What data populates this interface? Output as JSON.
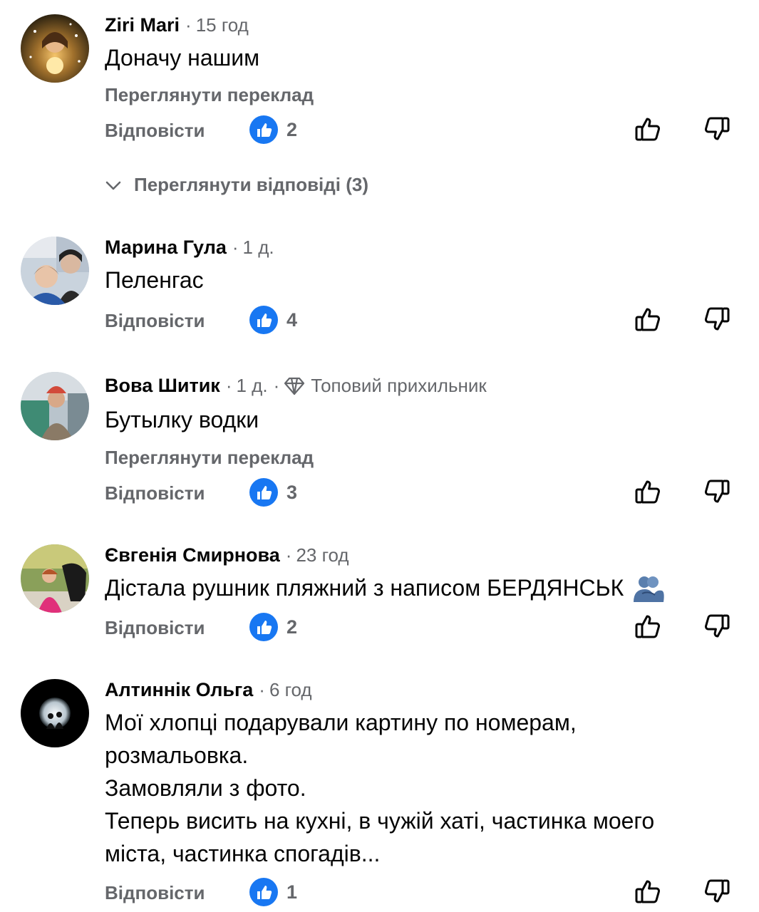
{
  "colors": {
    "accent": "#1877f2",
    "secondary": "#65676b",
    "text": "#050505"
  },
  "comments": [
    {
      "author": "Ziri Mari",
      "time": "15 год",
      "badge": "",
      "text_lines": [
        "Доначу нашим"
      ],
      "translate": "Переглянути переклад",
      "reply": "Відповісти",
      "likes": "2"
    },
    {
      "author": "Марина Гула",
      "time": "1 д.",
      "badge": "",
      "text_lines": [
        "Пеленгас"
      ],
      "translate": "",
      "reply": "Відповісти",
      "likes": "4"
    },
    {
      "author": "Вова Шитик",
      "time": "1 д.",
      "badge": "Топовий прихильник",
      "text_lines": [
        "Бутылку водки"
      ],
      "translate": "Переглянути переклад",
      "reply": "Відповісти",
      "likes": "3"
    },
    {
      "author": "Євгенія Смирнова",
      "time": "23 год",
      "badge": "",
      "text_lines": [
        "Дістала рушник пляжний з написом БЕРДЯНСЬК"
      ],
      "translate": "",
      "reply": "Відповісти",
      "likes": "2"
    },
    {
      "author": "Алтиннік Ольга",
      "time": "6 год",
      "badge": "",
      "text_lines": [
        "Мої хлопці подарували картину по номерам,",
        "розмальовка.",
        "Замовляли з фото.",
        "Теперь висить на кухні, в чужій хаті, частинка моего",
        "міста, частинка спогадів..."
      ],
      "translate": "",
      "reply": "Відповісти",
      "likes": "1"
    }
  ],
  "view_replies": "Переглянути відповіді (3)",
  "icons": {
    "like": "thumbs-up-icon",
    "dislike": "thumbs-down-icon",
    "reaction": "like-reaction-icon",
    "chevron": "chevron-down-icon",
    "diamond": "diamond-icon",
    "emoji": "people-hugging-emoji"
  }
}
